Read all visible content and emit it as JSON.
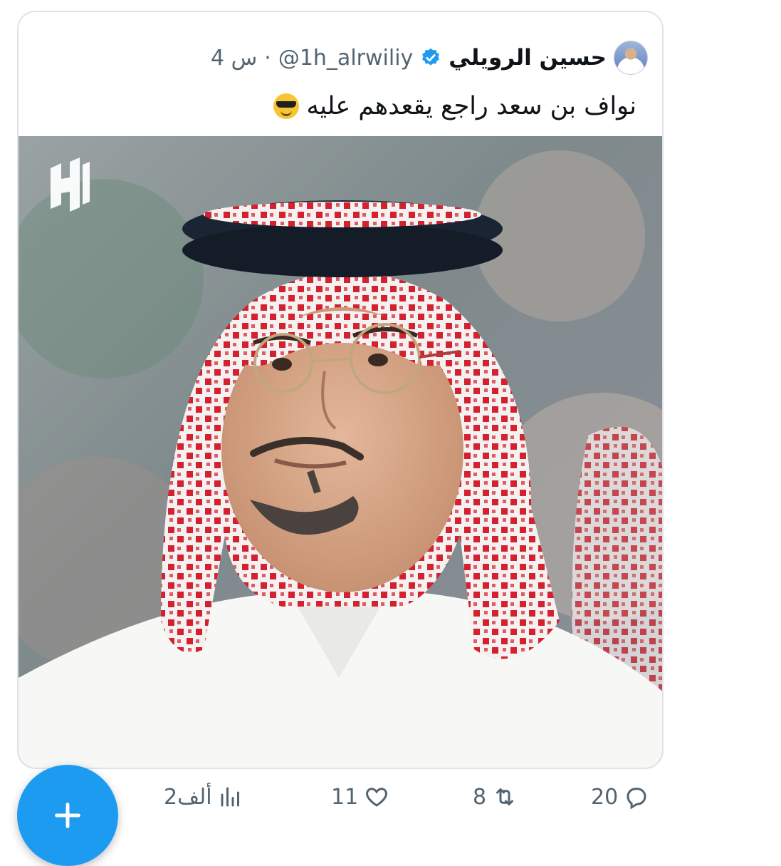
{
  "tweet": {
    "author_name": "حسين الرويلي",
    "handle": "@1h_alrwiliy",
    "separator": "·",
    "time": "4 س",
    "text": "نواف بن سعد راجع يقعدهم عليه",
    "emoji": "smiling-face-with-sunglasses",
    "verified": true
  },
  "actions": {
    "replies": "20",
    "retweets": "8",
    "likes": "11",
    "views": "2ألف"
  },
  "icons": {
    "reply": "reply-icon",
    "retweet": "retweet-icon",
    "like": "heart-icon",
    "views": "views-icon",
    "compose": "plus-icon",
    "logo": "club-logo"
  },
  "colors": {
    "accent": "#1d9bf0",
    "muted": "#536471",
    "text": "#0f1419",
    "border": "#dfe3e7"
  }
}
